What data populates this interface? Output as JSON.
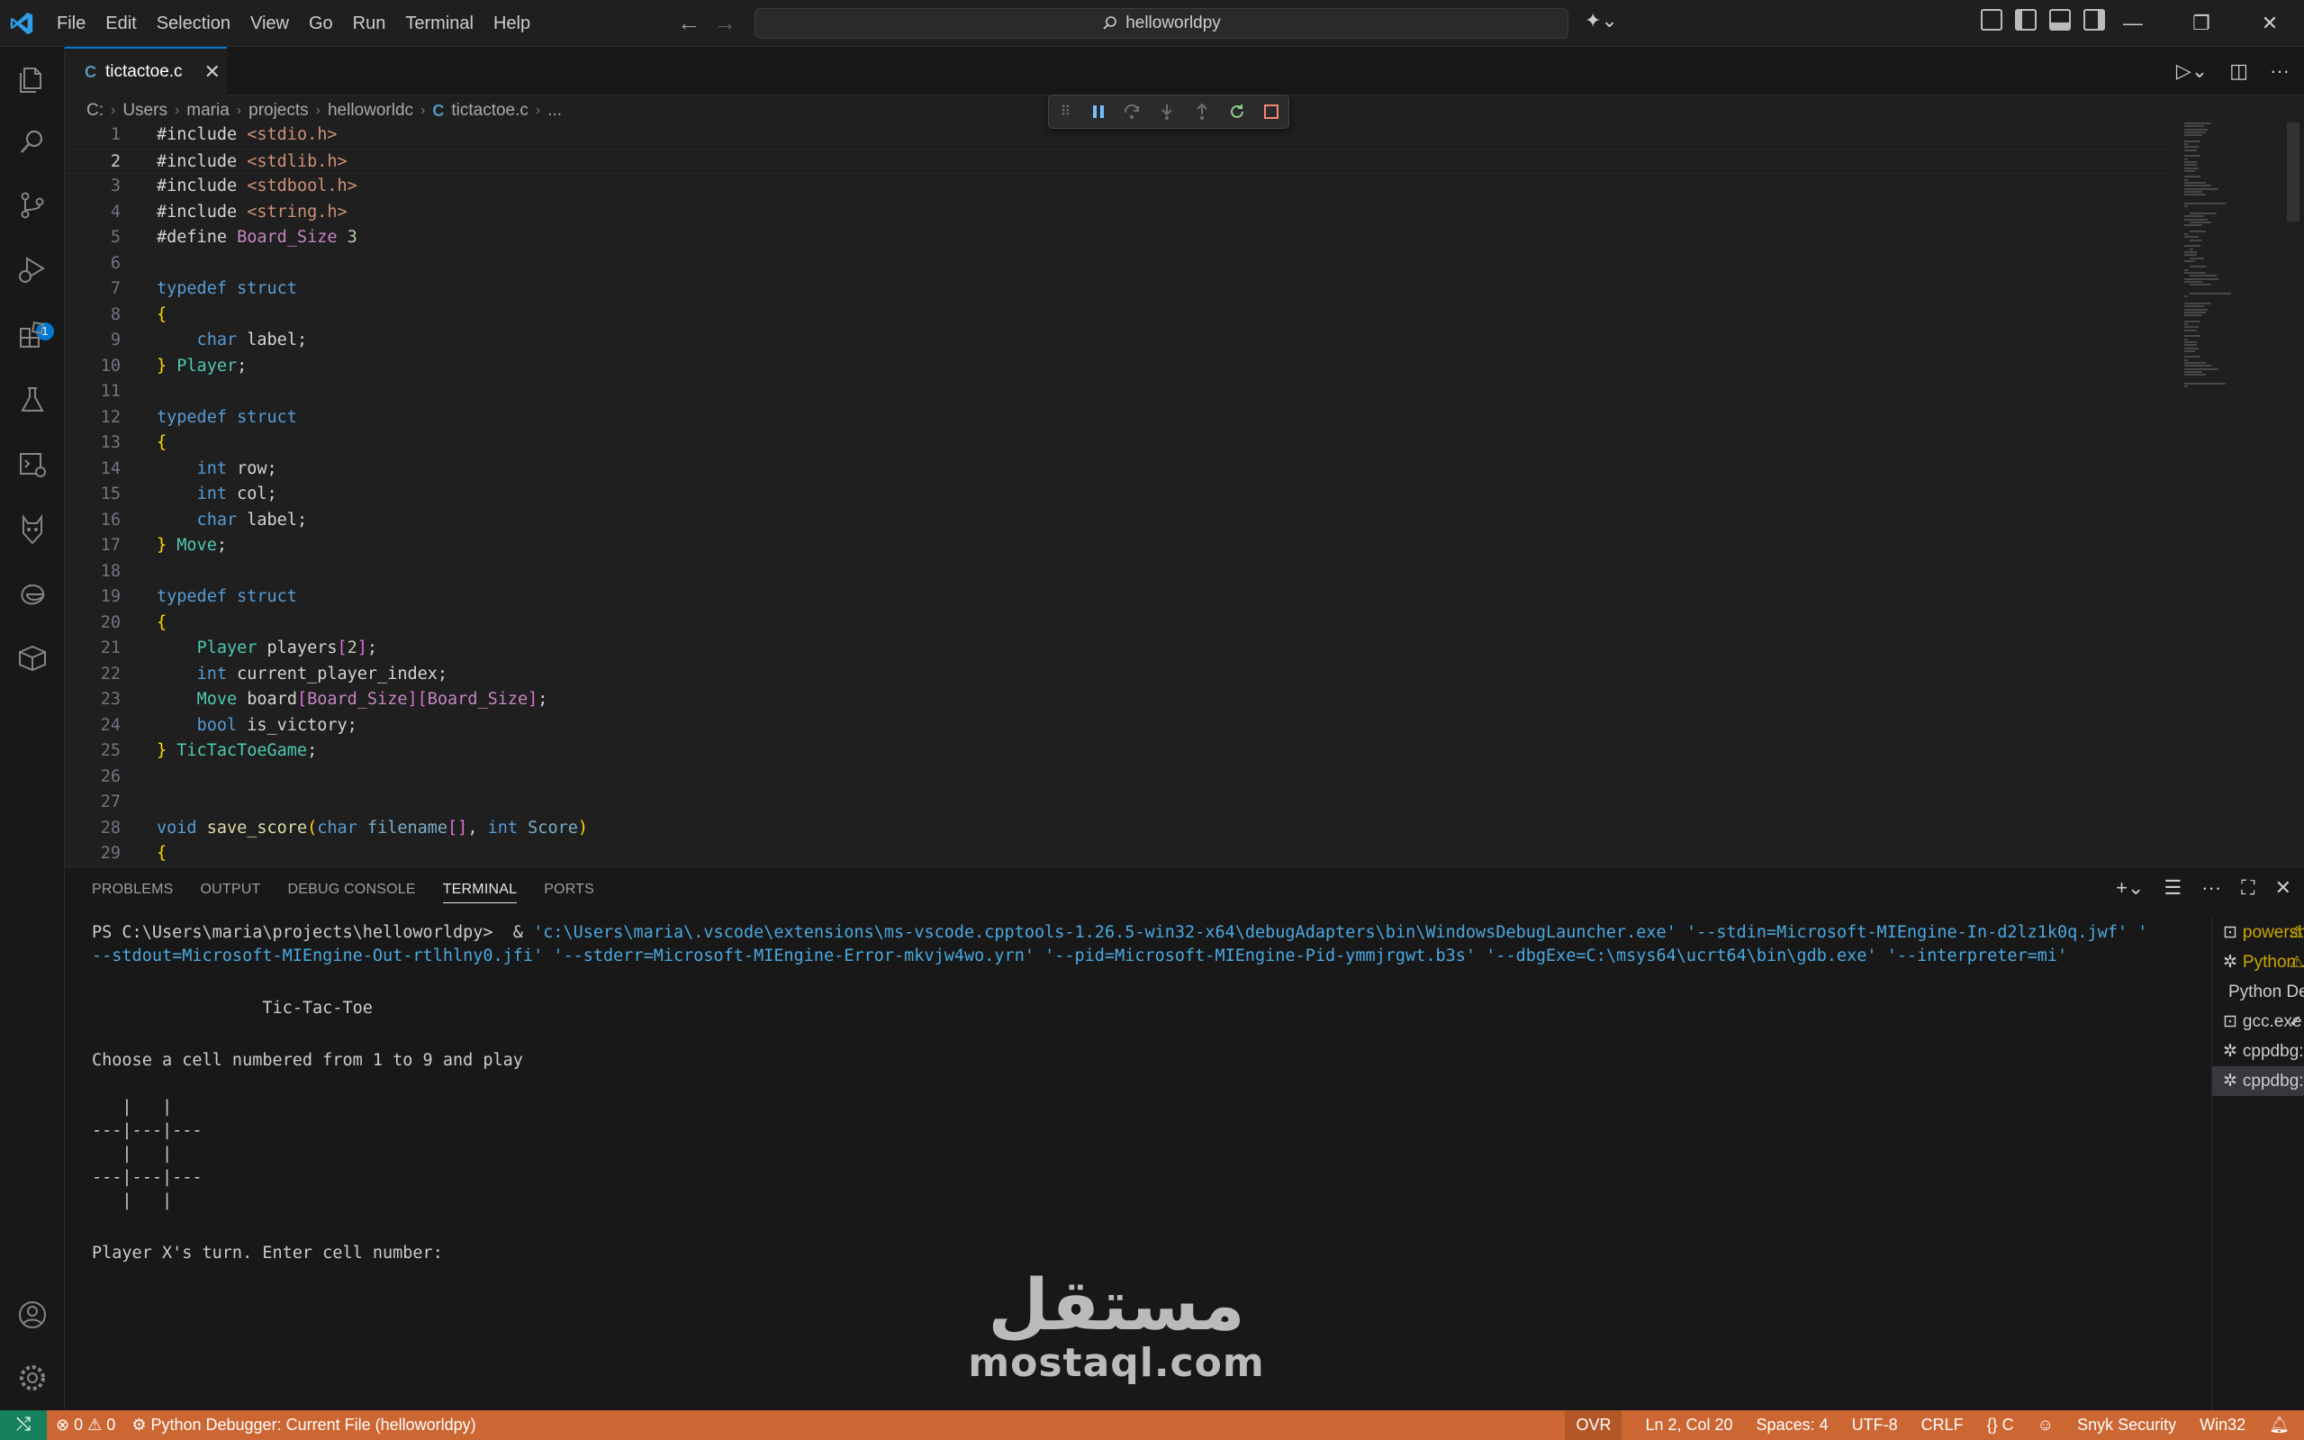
{
  "titlebar": {
    "menu": [
      "File",
      "Edit",
      "Selection",
      "View",
      "Go",
      "Run",
      "Terminal",
      "Help"
    ],
    "search": "helloworldpy"
  },
  "tab": {
    "label": "tictactoe.c",
    "lang_glyph": "C"
  },
  "breadcrumb": [
    "C:",
    "Users",
    "maria",
    "projects",
    "helloworldc",
    "tictactoe.c",
    "..."
  ],
  "activity_badge": "1",
  "code": [
    {
      "n": "1",
      "tokens": [
        [
          "t-plain",
          "#include "
        ],
        [
          "t-str",
          "<stdio.h>"
        ]
      ]
    },
    {
      "n": "2",
      "tokens": [
        [
          "t-plain",
          "#include "
        ],
        [
          "t-str",
          "<stdlib.h>"
        ]
      ]
    },
    {
      "n": "3",
      "tokens": [
        [
          "t-plain",
          "#include "
        ],
        [
          "t-str",
          "<stdbool.h>"
        ]
      ]
    },
    {
      "n": "4",
      "tokens": [
        [
          "t-plain",
          "#include "
        ],
        [
          "t-str",
          "<string.h>"
        ]
      ]
    },
    {
      "n": "5",
      "tokens": [
        [
          "t-plain",
          "#define "
        ],
        [
          "t-pre",
          "Board_Size"
        ],
        [
          "t-plain",
          " "
        ],
        [
          "t-num",
          "3"
        ]
      ]
    },
    {
      "n": "6",
      "tokens": []
    },
    {
      "n": "7",
      "tokens": [
        [
          "t-kw",
          "typedef"
        ],
        [
          "t-plain",
          " "
        ],
        [
          "t-kw",
          "struct"
        ]
      ]
    },
    {
      "n": "8",
      "tokens": [
        [
          "t-br1",
          "{"
        ]
      ]
    },
    {
      "n": "9",
      "tokens": [
        [
          "t-plain",
          "    "
        ],
        [
          "t-kw",
          "char"
        ],
        [
          "t-plain",
          " "
        ],
        [
          "t-plain",
          "label;"
        ]
      ]
    },
    {
      "n": "10",
      "tokens": [
        [
          "t-br1",
          "}"
        ],
        [
          "t-plain",
          " "
        ],
        [
          "t-type",
          "Player"
        ],
        [
          "t-plain",
          ";"
        ]
      ]
    },
    {
      "n": "11",
      "tokens": []
    },
    {
      "n": "12",
      "tokens": [
        [
          "t-kw",
          "typedef"
        ],
        [
          "t-plain",
          " "
        ],
        [
          "t-kw",
          "struct"
        ]
      ]
    },
    {
      "n": "13",
      "tokens": [
        [
          "t-br1",
          "{"
        ]
      ]
    },
    {
      "n": "14",
      "tokens": [
        [
          "t-plain",
          "    "
        ],
        [
          "t-kw",
          "int"
        ],
        [
          "t-plain",
          " row;"
        ]
      ]
    },
    {
      "n": "15",
      "tokens": [
        [
          "t-plain",
          "    "
        ],
        [
          "t-kw",
          "int"
        ],
        [
          "t-plain",
          " col;"
        ]
      ]
    },
    {
      "n": "16",
      "tokens": [
        [
          "t-plain",
          "    "
        ],
        [
          "t-kw",
          "char"
        ],
        [
          "t-plain",
          " label;"
        ]
      ]
    },
    {
      "n": "17",
      "tokens": [
        [
          "t-br1",
          "}"
        ],
        [
          "t-plain",
          " "
        ],
        [
          "t-type",
          "Move"
        ],
        [
          "t-plain",
          ";"
        ]
      ]
    },
    {
      "n": "18",
      "tokens": []
    },
    {
      "n": "19",
      "tokens": [
        [
          "t-kw",
          "typedef"
        ],
        [
          "t-plain",
          " "
        ],
        [
          "t-kw",
          "struct"
        ]
      ]
    },
    {
      "n": "20",
      "tokens": [
        [
          "t-br1",
          "{"
        ]
      ]
    },
    {
      "n": "21",
      "tokens": [
        [
          "t-plain",
          "    "
        ],
        [
          "t-type",
          "Player"
        ],
        [
          "t-plain",
          " players"
        ],
        [
          "t-br2",
          "["
        ],
        [
          "t-num",
          "2"
        ],
        [
          "t-br2",
          "]"
        ],
        [
          "t-plain",
          ";"
        ]
      ]
    },
    {
      "n": "22",
      "tokens": [
        [
          "t-plain",
          "    "
        ],
        [
          "t-kw",
          "int"
        ],
        [
          "t-plain",
          " current_player_index;"
        ]
      ]
    },
    {
      "n": "23",
      "tokens": [
        [
          "t-plain",
          "    "
        ],
        [
          "t-type",
          "Move"
        ],
        [
          "t-plain",
          " board"
        ],
        [
          "t-br2",
          "["
        ],
        [
          "t-pre",
          "Board_Size"
        ],
        [
          "t-br2",
          "]["
        ],
        [
          "t-pre",
          "Board_Size"
        ],
        [
          "t-br2",
          "]"
        ],
        [
          "t-plain",
          ";"
        ]
      ]
    },
    {
      "n": "24",
      "tokens": [
        [
          "t-plain",
          "    "
        ],
        [
          "t-kw",
          "bool"
        ],
        [
          "t-plain",
          " is_victory;"
        ]
      ]
    },
    {
      "n": "25",
      "tokens": [
        [
          "t-br1",
          "}"
        ],
        [
          "t-plain",
          " "
        ],
        [
          "t-type",
          "TicTacToeGame"
        ],
        [
          "t-plain",
          ";"
        ]
      ]
    },
    {
      "n": "26",
      "tokens": []
    },
    {
      "n": "27",
      "tokens": []
    },
    {
      "n": "28",
      "tokens": [
        [
          "t-kw",
          "void"
        ],
        [
          "t-plain",
          " "
        ],
        [
          "t-fn",
          "save_score"
        ],
        [
          "t-br1",
          "("
        ],
        [
          "t-kw",
          "char"
        ],
        [
          "t-plain",
          " "
        ],
        [
          "t-par",
          "filename"
        ],
        [
          "t-br2",
          "[]"
        ],
        [
          "t-plain",
          ", "
        ],
        [
          "t-kw",
          "int"
        ],
        [
          "t-plain",
          " "
        ],
        [
          "t-par",
          "Score"
        ],
        [
          "t-br1",
          ")"
        ]
      ]
    },
    {
      "n": "29",
      "tokens": [
        [
          "t-br1",
          "{"
        ]
      ]
    }
  ],
  "panel": {
    "tabs": [
      "PROBLEMS",
      "OUTPUT",
      "DEBUG CONSOLE",
      "TERMINAL",
      "PORTS"
    ],
    "active_tab": "TERMINAL",
    "terminal_lines": [
      {
        "text": "PS C:\\Users\\maria\\projects\\helloworldpy>  & ",
        "path": "'c:\\Users\\maria\\.vscode\\extensions\\ms-vscode.cpptools-1.26.5-win32-x64\\debugAdapters\\bin\\WindowsDebugLauncher.exe' '--stdin=Microsoft-MIEngine-In-d2lz1k0q.jwf' '"
      },
      {
        "text": "",
        "path": "--stdout=Microsoft-MIEngine-Out-rtlhlny0.jfi' '--stderr=Microsoft-MIEngine-Error-mkvjw4wo.yrn' '--pid=Microsoft-MIEngine-Pid-ymmjrgwt.b3s' '--dbgExe=C:\\msys64\\ucrt64\\bin\\gdb.exe' '--interpreter=mi'"
      },
      {
        "text": "",
        "path": ""
      },
      {
        "text": "                 Tic-Tac-Toe",
        "path": ""
      },
      {
        "text": "",
        "path": ""
      },
      {
        "text": "Choose a cell numbered from 1 to 9 and play",
        "path": ""
      },
      {
        "text": "",
        "path": ""
      },
      {
        "text": "   |   |",
        "path": ""
      },
      {
        "text": "---|---|---",
        "path": ""
      },
      {
        "text": "   |   |",
        "path": ""
      },
      {
        "text": "---|---|---",
        "path": ""
      },
      {
        "text": "   |   |",
        "path": ""
      },
      {
        "text": "",
        "path": ""
      },
      {
        "text": "Player X's turn. Enter cell number:",
        "path": ""
      }
    ],
    "terminals": [
      {
        "label": "powersh...",
        "icon": "terminal-icon",
        "status": "warning"
      },
      {
        "label": "Python ...",
        "icon": "debug-icon",
        "status": "warning"
      },
      {
        "label": "Python Deb...",
        "icon": "none",
        "status": ""
      },
      {
        "label": "gcc.exe ...",
        "icon": "terminal-icon",
        "status": "check"
      },
      {
        "label": "cppdbg: Uni...",
        "icon": "debug-icon",
        "status": ""
      },
      {
        "label": "cppdbg: tict...",
        "icon": "debug-icon",
        "status": ""
      }
    ]
  },
  "watermark": {
    "arabic": "مستقل",
    "latin": "mostaql.com"
  },
  "statusbar": {
    "errors": "0",
    "warnings": "0",
    "debug_config": "Python Debugger: Current File (helloworldpy)",
    "ovr": "OVR",
    "cursor": "Ln 2, Col 20",
    "spaces": "Spaces: 4",
    "encoding": "UTF-8",
    "eol": "CRLF",
    "language": "C",
    "snyk": "Snyk Security",
    "platform": "Win32"
  },
  "colors": {
    "accent": "#0078d4",
    "statusbar": "#cc6633",
    "remote": "#16825d"
  }
}
